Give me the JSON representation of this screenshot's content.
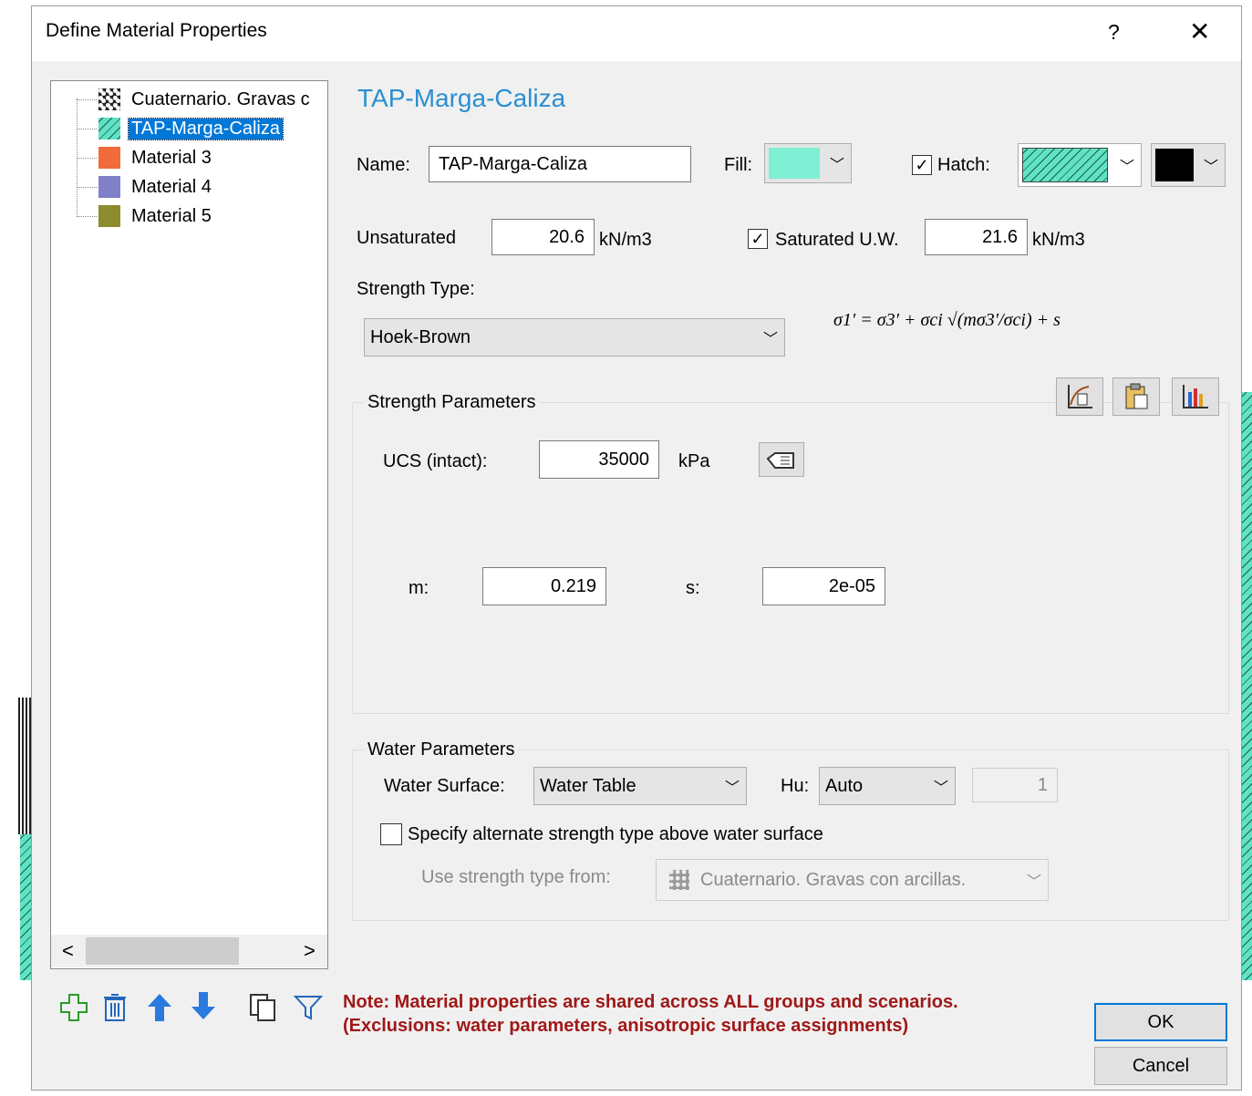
{
  "window": {
    "title": "Define Material Properties",
    "help_label": "?",
    "close_label": "✕"
  },
  "materials": [
    {
      "label": "Cuaternario. Gravas c",
      "color": "#222222",
      "icon": "gravel-pattern-icon"
    },
    {
      "label": "TAP-Marga-Caliza",
      "color": "#6ee8cc",
      "icon": "hatch-pattern-icon",
      "selected": true
    },
    {
      "label": "Material 3",
      "color": "#f26b3a"
    },
    {
      "label": "Material 4",
      "color": "#8080c8"
    },
    {
      "label": "Material 5",
      "color": "#8c8c2e"
    }
  ],
  "scrollbar": {
    "left": "<",
    "right": ">"
  },
  "heading": "TAP-Marga-Caliza",
  "name": {
    "label": "Name:",
    "value": "TAP-Marga-Caliza"
  },
  "fill": {
    "label": "Fill:",
    "color": "#7ff0d4"
  },
  "hatch": {
    "label": "Hatch:",
    "checked": true,
    "color": "#6ee8cc",
    "line_color": "#000000"
  },
  "unit_weight": {
    "unsat_label": "Unsaturated",
    "unsat_value": "20.6",
    "unsat_unit": "kN/m3",
    "sat_label": "Saturated U.W.",
    "sat_checked": true,
    "sat_value": "21.6",
    "sat_unit": "kN/m3"
  },
  "strength_type": {
    "label": "Strength Type:",
    "value": "Hoek-Brown"
  },
  "formula": "σ1′ = σ3′ + σci √(mσ3′/σci) + s",
  "strength_parameters": {
    "title": "Strength Parameters",
    "ucs_label": "UCS (intact):",
    "ucs_value": "35000",
    "ucs_unit": "kPa",
    "m_label": "m:",
    "m_value": "0.219",
    "s_label": "s:",
    "s_value": "2e-05"
  },
  "water_parameters": {
    "title": "Water Parameters",
    "surface_label": "Water Surface:",
    "surface_value": "Water Table",
    "hu_label": "Hu:",
    "hu_value": "Auto",
    "hu_number": "1",
    "alt_label": "Specify alternate strength type above water surface",
    "use_from_label": "Use strength type from:",
    "use_from_value": "Cuaternario. Gravas con arcillas."
  },
  "note": {
    "line1": "Note: Material properties are shared across ALL groups and scenarios.",
    "line2": "(Exclusions: water parameters, anisotropic surface assignments)"
  },
  "buttons": {
    "ok": "OK",
    "cancel": "Cancel"
  },
  "colors": {
    "accent": "#2a8fd0",
    "note": "#a01818",
    "selection": "#0078d7"
  }
}
